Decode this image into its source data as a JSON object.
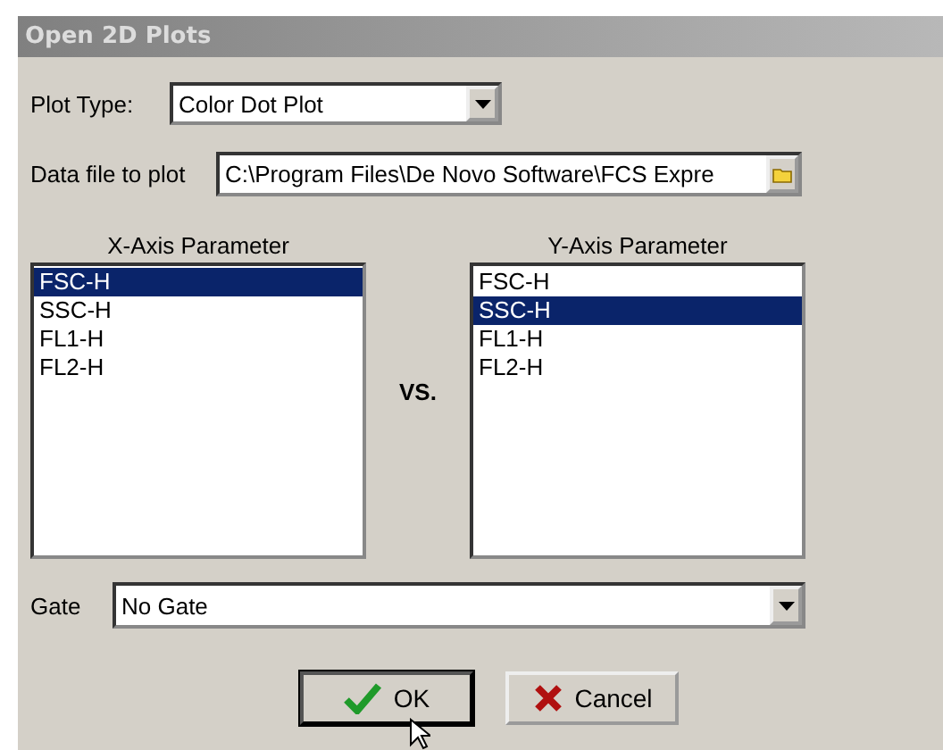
{
  "window": {
    "title": "Open 2D Plots"
  },
  "plot_type": {
    "label": "Plot Type:",
    "value": "Color Dot Plot"
  },
  "data_file": {
    "label": "Data file to plot",
    "value": "C:\\Program Files\\De Novo Software\\FCS Expre"
  },
  "x_axis": {
    "label": "X-Axis Parameter",
    "items": [
      {
        "text": "FSC-H",
        "selected": true
      },
      {
        "text": "SSC-H",
        "selected": false
      },
      {
        "text": "FL1-H",
        "selected": false
      },
      {
        "text": "FL2-H",
        "selected": false
      }
    ]
  },
  "vs_label": "VS.",
  "y_axis": {
    "label": "Y-Axis Parameter",
    "items": [
      {
        "text": "FSC-H",
        "selected": false
      },
      {
        "text": "SSC-H",
        "selected": true
      },
      {
        "text": "FL1-H",
        "selected": false
      },
      {
        "text": "FL2-H",
        "selected": false
      }
    ]
  },
  "gate": {
    "label": "Gate",
    "value": "No Gate"
  },
  "buttons": [
    {
      "kind": "ok",
      "label": "OK"
    },
    {
      "kind": "cancel",
      "label": "Cancel"
    }
  ]
}
